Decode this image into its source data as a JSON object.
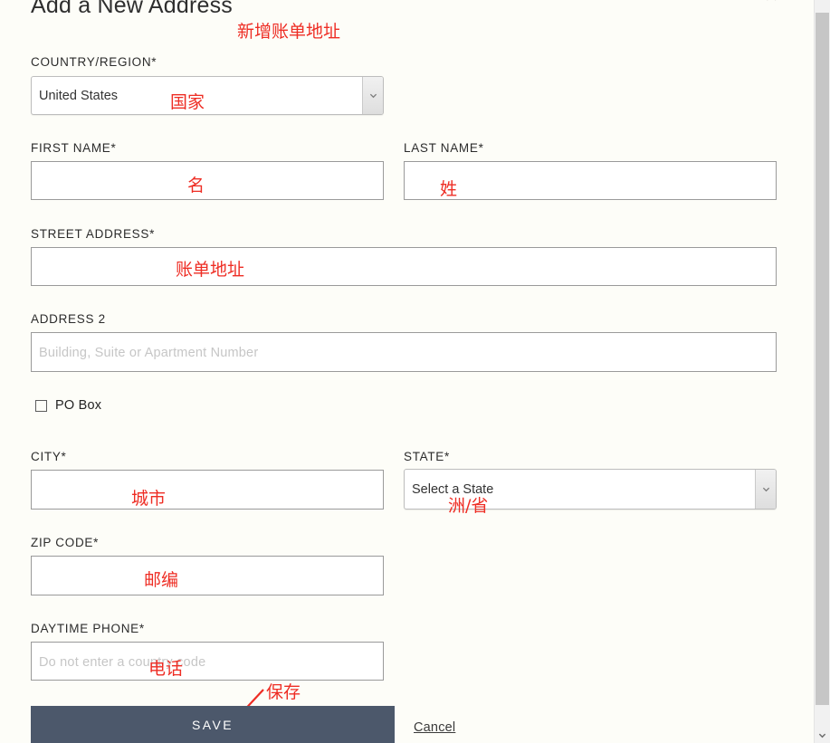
{
  "page": {
    "title": "Add a New Address",
    "top_artifact": "· ·"
  },
  "form": {
    "country": {
      "label": "COUNTRY/REGION*",
      "value": "United States",
      "options": [
        "United States"
      ]
    },
    "first_name": {
      "label": "FIRST NAME*",
      "value": "",
      "placeholder": ""
    },
    "last_name": {
      "label": "LAST NAME*",
      "value": "",
      "placeholder": ""
    },
    "street_address": {
      "label": "STREET ADDRESS*",
      "value": "",
      "placeholder": ""
    },
    "address2": {
      "label": "ADDRESS 2",
      "value": "",
      "placeholder": "Building, Suite or Apartment Number"
    },
    "po_box": {
      "label": "PO Box",
      "checked": false
    },
    "city": {
      "label": "CITY*",
      "value": "",
      "placeholder": ""
    },
    "state": {
      "label": "STATE*",
      "value": "Select a State",
      "options": [
        "Select a State"
      ]
    },
    "zip_code": {
      "label": "ZIP CODE*",
      "value": "",
      "placeholder": ""
    },
    "daytime_phone": {
      "label": "DAYTIME PHONE*",
      "value": "",
      "placeholder": "Do not enter a country code"
    }
  },
  "actions": {
    "save_label": "SAVE",
    "cancel_label": "Cancel"
  },
  "annotations": {
    "title": "新增账单地址",
    "country": "国家",
    "first_name": "名",
    "last_name": "姓",
    "street_address": "账单地址",
    "city": "城市",
    "state": "洲/省",
    "zip_code": "邮编",
    "phone": "电话",
    "save": "保存"
  },
  "colors": {
    "background": "#fdfdf8",
    "save_button": "#4c586b",
    "annotation_red": "#ee2d24",
    "input_border": "#9a9a9a",
    "placeholder": "#c6c6c6"
  },
  "scrollbar": {
    "orientation": "vertical",
    "thumb_color": "#c6c6c6",
    "track_color": "#f1f1f1"
  }
}
